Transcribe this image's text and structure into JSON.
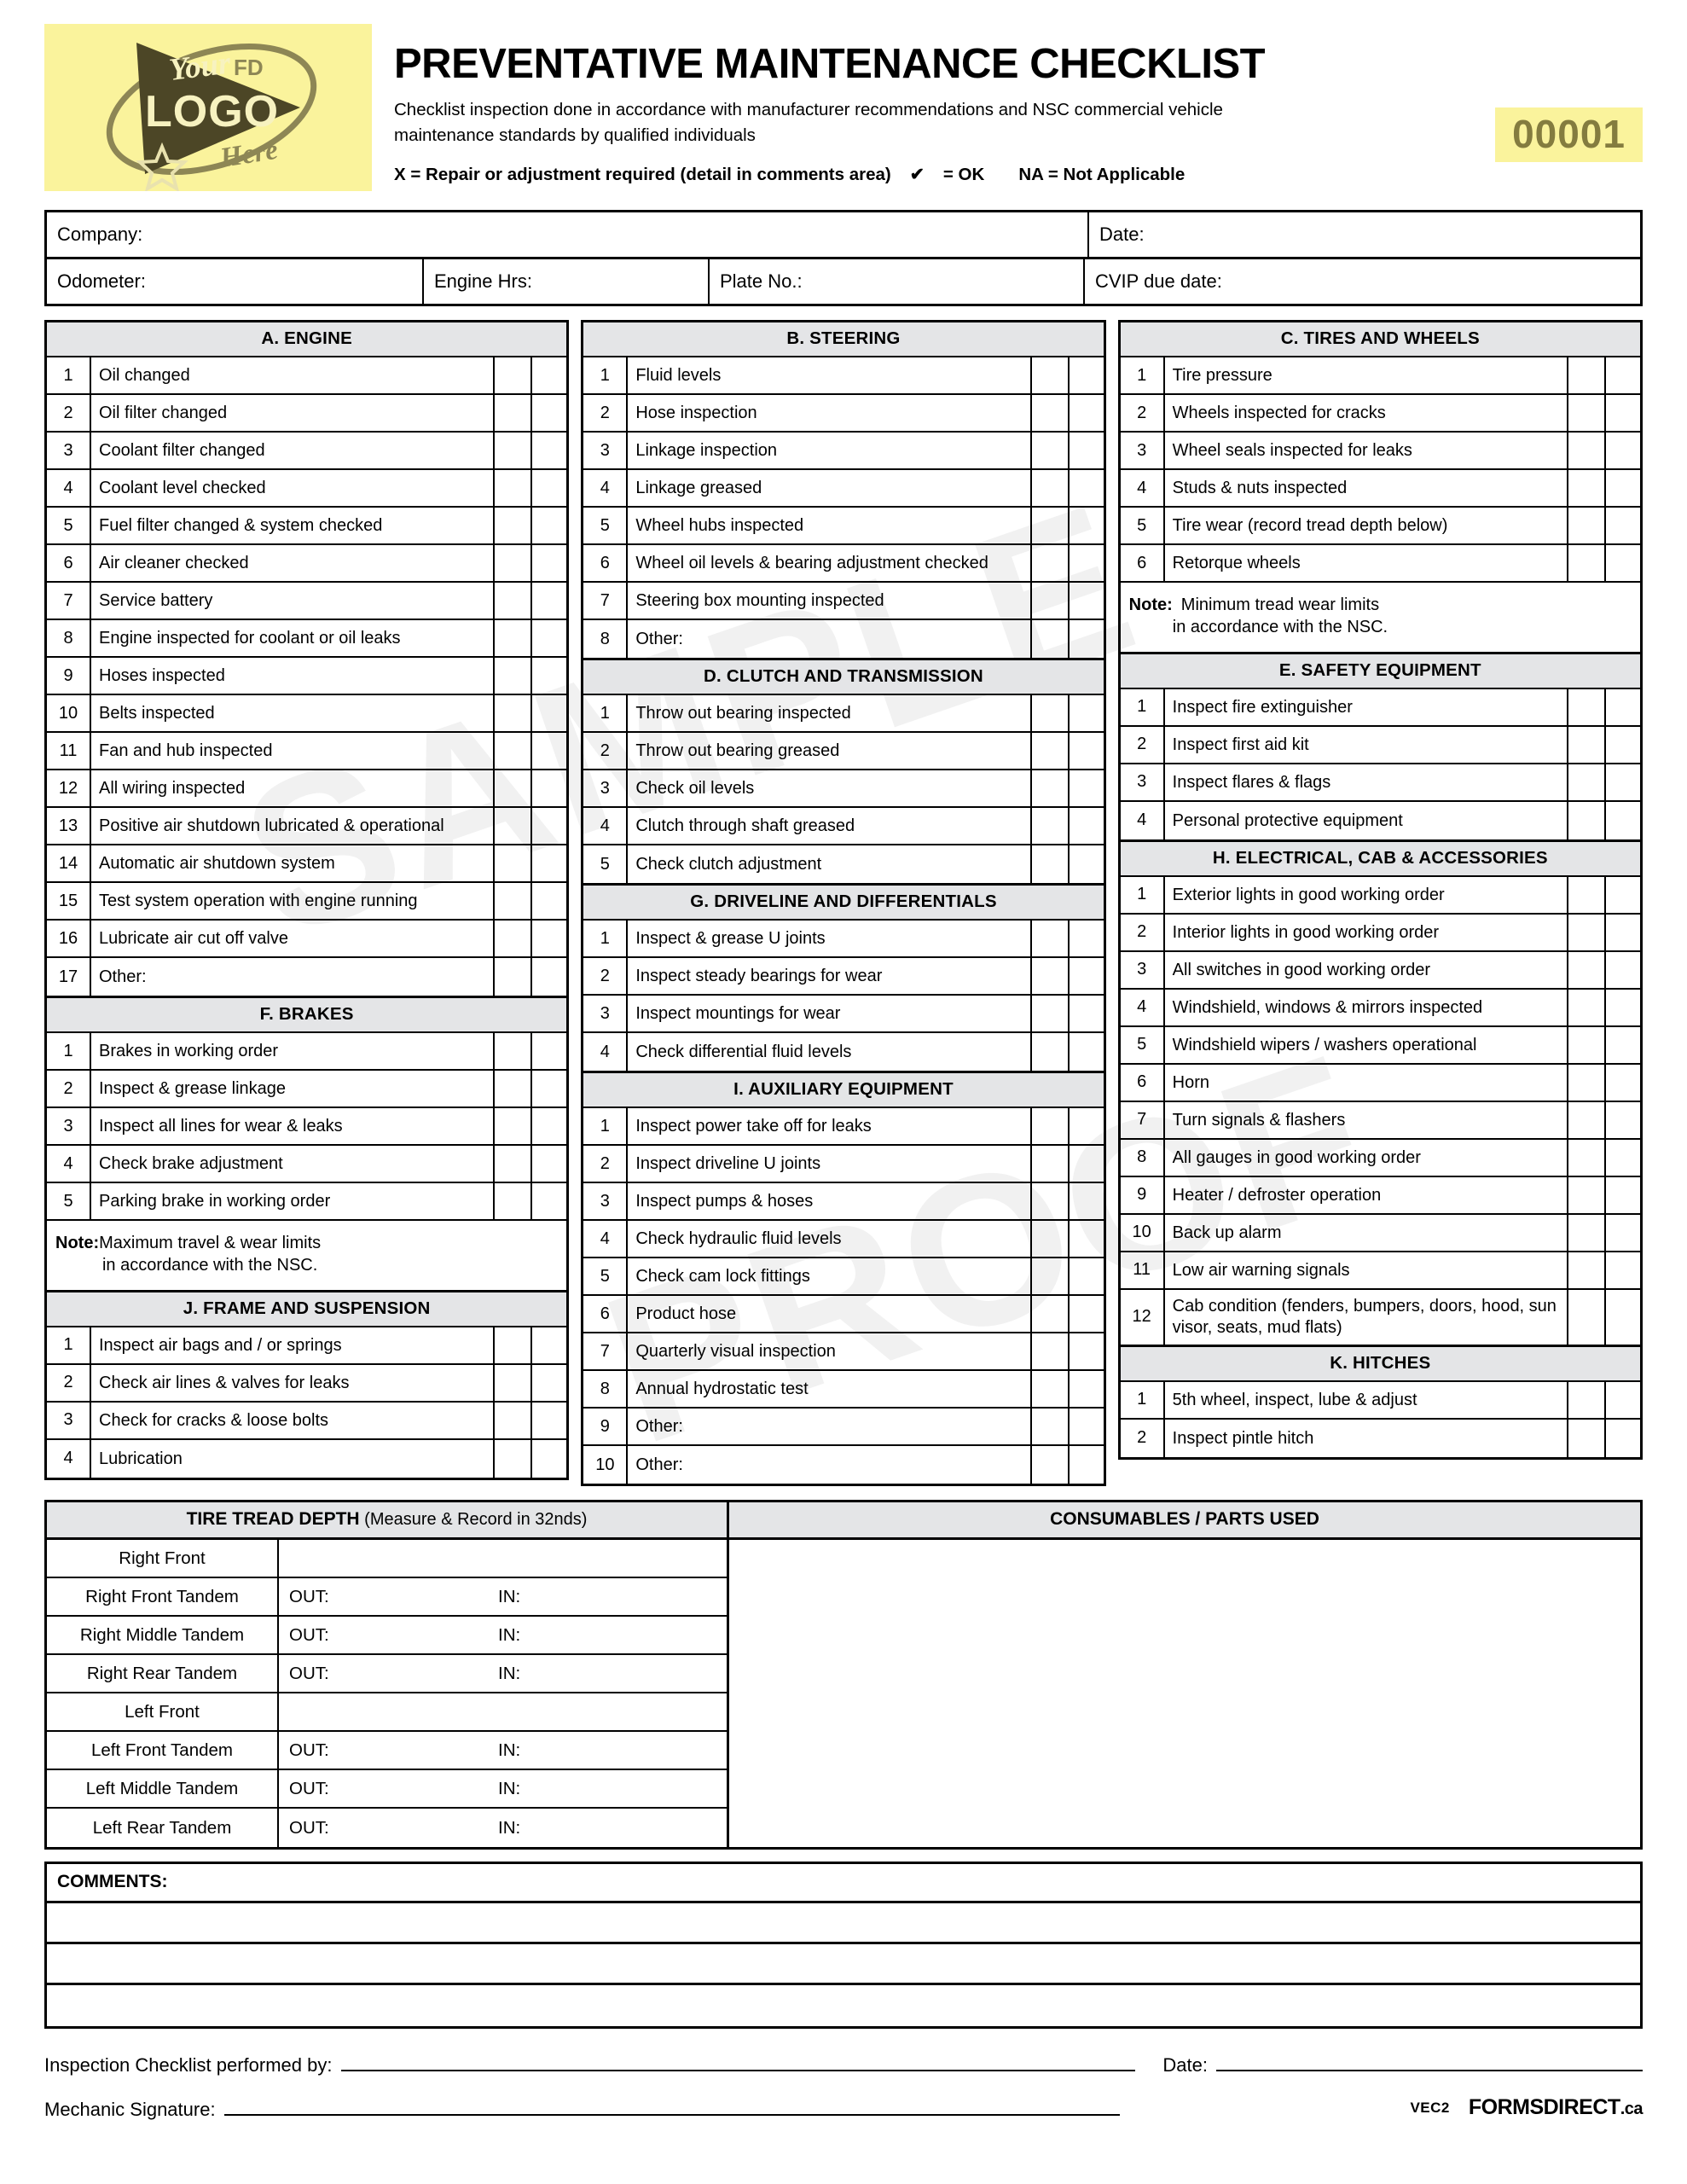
{
  "header": {
    "logo_alt": "Your LOGO Here",
    "logo_fd": "FD",
    "logo_your": "Your",
    "logo_main": "LOGO",
    "logo_here": "Here",
    "title": "PREVENTATIVE MAINTENANCE CHECKLIST",
    "subtitle": "Checklist inspection done in accordance with manufacturer recommendations and NSC commercial vehicle maintenance standards by qualified individuals",
    "legend_x": "X = Repair or adjustment required (detail in comments area)",
    "legend_check": "= OK",
    "legend_na": "NA = Not Applicable",
    "form_number": "00001",
    "badge_color": "#faf39c",
    "badge_text_color": "#847c3f"
  },
  "info": {
    "company": "Company:",
    "date": "Date:",
    "odometer": "Odometer:",
    "engine_hrs": "Engine Hrs:",
    "plate_no": "Plate No.:",
    "cvip_due": "CVIP due date:"
  },
  "columns": [
    {
      "sections": [
        {
          "title": "A. ENGINE",
          "items": [
            "Oil changed",
            "Oil filter changed",
            "Coolant filter changed",
            "Coolant level checked",
            "Fuel filter changed & system checked",
            "Air cleaner checked",
            "Service battery",
            "Engine inspected for coolant or oil leaks",
            "Hoses inspected",
            "Belts inspected",
            "Fan and hub inspected",
            "All wiring inspected",
            "Positive air shutdown lubricated & operational",
            "Automatic air shutdown system",
            "Test system operation with engine running",
            "Lubricate air cut off valve",
            "Other:"
          ]
        },
        {
          "title": "F. BRAKES",
          "items": [
            "Brakes in working order",
            "Inspect & grease linkage",
            "Inspect all lines for wear & leaks",
            "Check brake adjustment",
            "Parking brake in working order"
          ],
          "note_bold": "Note:",
          "note_rest": " Maximum travel & wear limits",
          "note_line2": "in accordance with the NSC."
        },
        {
          "title": "J. FRAME AND SUSPENSION",
          "items": [
            "Inspect air bags and / or springs",
            "Check air lines & valves for leaks",
            "Check for cracks & loose bolts",
            "Lubrication"
          ]
        }
      ]
    },
    {
      "sections": [
        {
          "title": "B. STEERING",
          "items": [
            "Fluid levels",
            "Hose inspection",
            "Linkage inspection",
            "Linkage greased",
            "Wheel hubs inspected",
            "Wheel oil levels & bearing adjustment checked",
            "Steering box mounting inspected",
            "Other:"
          ]
        },
        {
          "title": "D. CLUTCH AND TRANSMISSION",
          "items": [
            "Throw out bearing inspected",
            "Throw out bearing greased",
            "Check oil levels",
            "Clutch through shaft greased",
            "Check clutch adjustment"
          ]
        },
        {
          "title": "G. DRIVELINE AND DIFFERENTIALS",
          "items": [
            "Inspect & grease U joints",
            "Inspect steady bearings for wear",
            "Inspect mountings for wear",
            "Check differential fluid levels"
          ]
        },
        {
          "title": "I. AUXILIARY EQUIPMENT",
          "items": [
            "Inspect power take off for leaks",
            "Inspect driveline U joints",
            "Inspect pumps & hoses",
            "Check hydraulic fluid levels",
            "Check cam lock fittings",
            "Product hose",
            "Quarterly visual inspection",
            "Annual hydrostatic test",
            "Other:",
            "Other:"
          ]
        }
      ]
    },
    {
      "sections": [
        {
          "title": "C. TIRES AND WHEELS",
          "items": [
            "Tire pressure",
            "Wheels inspected for cracks",
            "Wheel seals inspected for leaks",
            "Studs & nuts inspected",
            "Tire wear (record tread depth below)",
            "Retorque wheels"
          ],
          "note_bold": "Note:",
          "note_rest": " Minimum tread wear limits",
          "note_line2": "in accordance with the NSC."
        },
        {
          "title": "E. SAFETY EQUIPMENT",
          "items": [
            "Inspect fire extinguisher",
            "Inspect first aid kit",
            "Inspect flares & flags",
            "Personal protective equipment"
          ]
        },
        {
          "title": "H. ELECTRICAL, CAB & ACCESSORIES",
          "items": [
            "Exterior lights in good working order",
            "Interior lights in good working order",
            "All switches in good working order",
            "Windshield, windows & mirrors inspected",
            "Windshield wipers / washers operational",
            "Horn",
            "Turn signals & flashers",
            "All gauges in good working order",
            "Heater / defroster operation",
            "Back up alarm",
            "Low air warning signals",
            "Cab condition (fenders, bumpers, doors, hood, sun visor, seats, mud flats)"
          ]
        },
        {
          "title": "K. HITCHES",
          "items": [
            "5th wheel, inspect, lube & adjust",
            "Inspect pintle hitch"
          ]
        }
      ]
    }
  ],
  "tread": {
    "title_bold": "TIRE TREAD DEPTH",
    "title_soft": " (Measure & Record in 32nds)",
    "out_label": "OUT:",
    "in_label": "IN:",
    "rows": [
      {
        "position": "Right Front",
        "has_values": false
      },
      {
        "position": "Right Front Tandem",
        "has_values": true
      },
      {
        "position": "Right Middle Tandem",
        "has_values": true
      },
      {
        "position": "Right Rear Tandem",
        "has_values": true
      },
      {
        "position": "Left Front",
        "has_values": false
      },
      {
        "position": "Left Front Tandem",
        "has_values": true
      },
      {
        "position": "Left Middle Tandem",
        "has_values": true
      },
      {
        "position": "Left Rear Tandem",
        "has_values": true
      }
    ]
  },
  "consumables": {
    "title": "CONSUMABLES / PARTS USED"
  },
  "comments": {
    "label": "COMMENTS:",
    "line_count": 3
  },
  "footer": {
    "performed_by": "Inspection Checklist performed by:",
    "date": "Date:",
    "mechanic_signature": "Mechanic Signature:",
    "vec": "VEC2",
    "brand": "FORMSDIRECT",
    "brand_tld": ".ca"
  },
  "watermarks": {
    "sample": "SAMPLE",
    "proof": "PROOF"
  }
}
